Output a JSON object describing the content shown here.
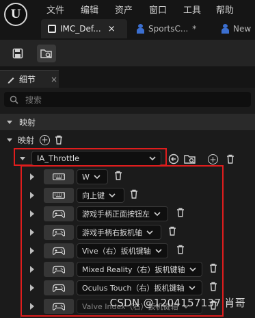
{
  "app": {
    "logo_letter": "U"
  },
  "menu": [
    "文件",
    "编辑",
    "资产",
    "窗口",
    "工具",
    "帮助"
  ],
  "tabs": [
    {
      "label": "IMC_Def...",
      "close": "×",
      "active": true
    },
    {
      "label": "SportsC...",
      "modified": "*",
      "active": false
    },
    {
      "label": "New",
      "active": false
    }
  ],
  "panel": {
    "tab_label": "细节",
    "tab_close": "×"
  },
  "search": {
    "placeholder": "搜索"
  },
  "sections": {
    "mapping_category": "映射",
    "mapping_label": "映射"
  },
  "action": {
    "value": "IA_Throttle"
  },
  "bindings": [
    {
      "icon": "keyboard-icon",
      "label": "W"
    },
    {
      "icon": "keyboard-icon",
      "label": "向上键"
    },
    {
      "icon": "gamepad-icon",
      "label": "游戏手柄正面按钮左"
    },
    {
      "icon": "gamepad-icon",
      "label": "游戏手柄右扳机轴"
    },
    {
      "icon": "gamepad-icon",
      "label": "Vive（右）扳机键轴"
    },
    {
      "icon": "gamepad-icon",
      "label": "Mixed Reality（右）扳机键轴"
    },
    {
      "icon": "gamepad-icon",
      "label": "Oculus Touch（右）扳机键轴"
    },
    {
      "icon": "gamepad-icon",
      "label": "Valve Index（右）扳机键轴"
    }
  ],
  "watermark": "CSDN @1204157137 肖哥",
  "colors": {
    "highlight_border": "#e01d1d",
    "accent_blue": "#3b6fd0",
    "background": "#1b1b1b"
  }
}
